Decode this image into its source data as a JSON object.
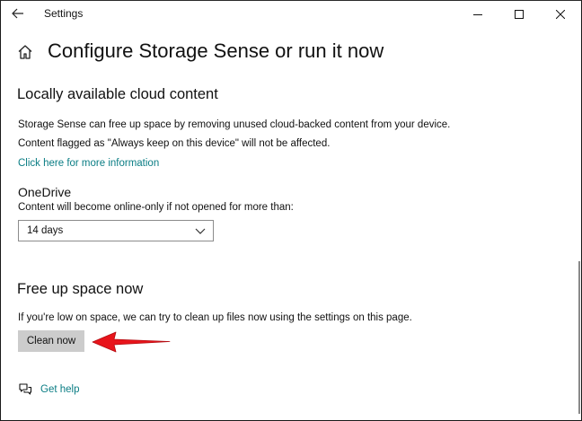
{
  "window": {
    "title": "Settings",
    "back_icon": "back-arrow-icon",
    "controls": [
      "minimize-icon",
      "maximize-icon",
      "close-icon"
    ]
  },
  "header": {
    "icon": "home-icon",
    "title": "Configure Storage Sense or run it now"
  },
  "cloud": {
    "heading": "Locally available cloud content",
    "desc1": "Storage Sense can free up space by removing unused cloud-backed content from your device.",
    "desc2": "Content flagged as \"Always keep on this device\" will not be affected.",
    "link": "Click here for more information"
  },
  "onedrive": {
    "heading": "OneDrive",
    "desc": "Content will become online-only if not opened for more than:",
    "selected": "14 days"
  },
  "free_up": {
    "heading": "Free up space now",
    "desc": "If you're low on space, we can try to clean up files now using the settings on this page.",
    "button": "Clean now"
  },
  "help": {
    "icon": "help-chat-icon",
    "label": "Get help"
  },
  "colors": {
    "link": "#0a7d84",
    "button_bg": "#cccccc",
    "annotation_arrow": "#e8141b"
  }
}
